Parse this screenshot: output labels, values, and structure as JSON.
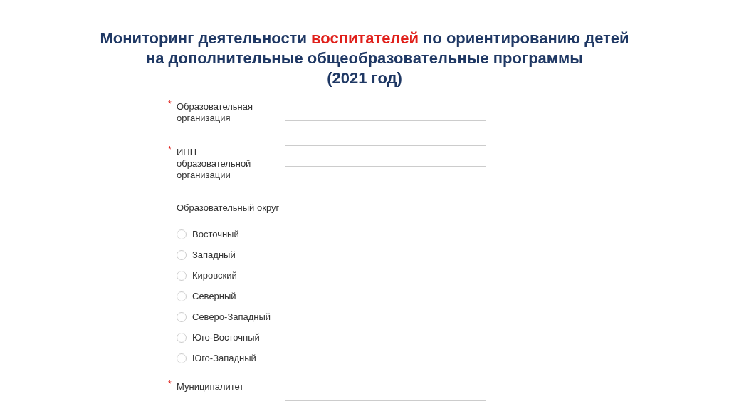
{
  "title_lines": [
    [
      {
        "kind": "normal",
        "text": "Мониторинг деятельности "
      },
      {
        "kind": "highlight",
        "text": "воспитателей"
      },
      {
        "kind": "normal",
        "text": " по ориентированию детей"
      }
    ],
    [
      {
        "kind": "normal",
        "text": "на дополнительные общеобразовательные программы"
      }
    ],
    [
      {
        "kind": "normal",
        "text": "(2021 год)"
      }
    ]
  ],
  "form": [
    {
      "kind": "text",
      "required": true,
      "required_mark": "*",
      "label": "Образовательная организация"
    },
    {
      "kind": "text",
      "required": true,
      "required_mark": "*",
      "label": "ИНН образовательной организации"
    },
    {
      "kind": "radio",
      "label": "Образовательный округ",
      "options": [
        {
          "label": "Восточный",
          "selected": false
        },
        {
          "label": "Западный",
          "selected": false
        },
        {
          "label": "Кировский",
          "selected": false
        },
        {
          "label": "Северный",
          "selected": false
        },
        {
          "label": "Северо-Западный",
          "selected": false
        },
        {
          "label": "Юго-Восточный",
          "selected": false
        },
        {
          "label": "Юго-Западный",
          "selected": false
        }
      ]
    },
    {
      "kind": "text",
      "required": true,
      "required_mark": "*",
      "label": "Муниципалитет"
    }
  ]
}
